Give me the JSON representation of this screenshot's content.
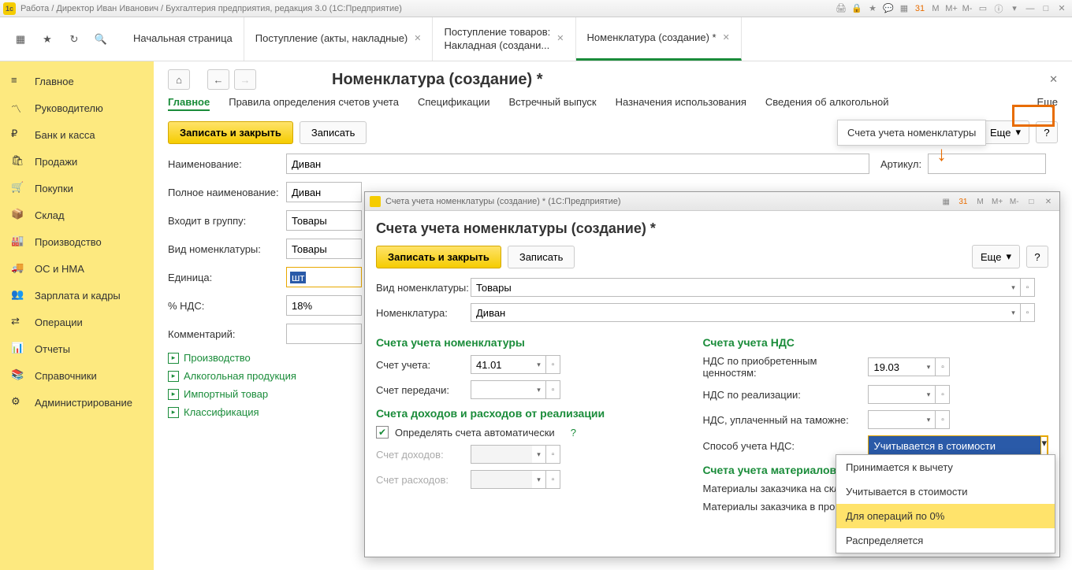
{
  "titlebar": {
    "text": "Работа / Директор Иван Иванович / Бухгалтерия предприятия, редакция 3.0  (1С:Предприятие)"
  },
  "tabs": {
    "home": "Начальная страница",
    "t1": "Поступление (акты, накладные)",
    "t2": "Поступление товаров:\nНакладная (создани...",
    "t3": "Номенклатура (создание) *"
  },
  "sidebar": [
    "Главное",
    "Руководителю",
    "Банк и касса",
    "Продажи",
    "Покупки",
    "Склад",
    "Производство",
    "ОС и НМА",
    "Зарплата и кадры",
    "Операции",
    "Отчеты",
    "Справочники",
    "Администрирование"
  ],
  "page": {
    "title": "Номенклатура (создание) *",
    "section_tabs": [
      "Главное",
      "Правила определения счетов учета",
      "Спецификации",
      "Встречный выпуск",
      "Назначения использования",
      "Сведения об алкогольной"
    ],
    "save_close": "Записать и закрыть",
    "save": "Записать",
    "more": "Еще",
    "tooltip": "Счета учета номенклатуры"
  },
  "form": {
    "name_lbl": "Наименование:",
    "name": "Диван",
    "article_lbl": "Артикул:",
    "fullname_lbl": "Полное наименование:",
    "fullname": "Диван",
    "group_lbl": "Входит в группу:",
    "group": "Товары",
    "kind_lbl": "Вид номенклатуры:",
    "kind": "Товары",
    "unit_lbl": "Единица:",
    "unit": "шт",
    "vat_lbl": "% НДС:",
    "vat": "18%",
    "comment_lbl": "Комментарий:",
    "links": [
      "Производство",
      "Алкогольная продукция",
      "Импортный товар",
      "Классификация"
    ]
  },
  "modal": {
    "bar": "Счета учета номенклатуры (создание) *  (1С:Предприятие)",
    "title": "Счета учета номенклатуры (создание) *",
    "save_close": "Записать и закрыть",
    "save": "Записать",
    "more": "Еще",
    "kind_lbl": "Вид номенклатуры:",
    "kind": "Товары",
    "nom_lbl": "Номенклатура:",
    "nom": "Диван",
    "sec1": "Счета учета номенклатуры",
    "acc_lbl": "Счет учета:",
    "acc": "41.01",
    "transfer_lbl": "Счет передачи:",
    "sec2": "Счета учета НДС",
    "vat_acq_lbl": "НДС по приобретенным ценностям:",
    "vat_acq": "19.03",
    "vat_sale_lbl": "НДС по реализации:",
    "vat_cust_lbl": "НДС, уплаченный на таможне:",
    "vat_method_lbl": "Способ учета НДС:",
    "vat_method": "Учитывается в стоимости",
    "sec3": "Счета доходов и расходов от реализации",
    "auto_lbl": "Определять счета автоматически",
    "income_lbl": "Счет доходов:",
    "expense_lbl": "Счет расходов:",
    "sec4": "Счета учета материалов,",
    "mat1_lbl": "Материалы заказчика на складе",
    "mat2_lbl": "Материалы заказчика в произво..."
  },
  "dropdown": [
    "Принимается к вычету",
    "Учитывается в стоимости",
    "Для операций по 0%",
    "Распределяется"
  ]
}
